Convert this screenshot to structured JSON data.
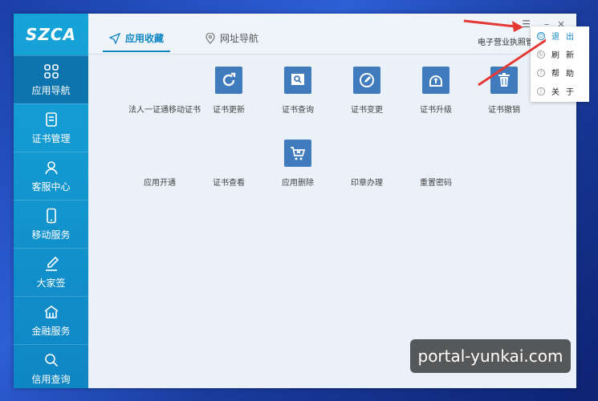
{
  "app": {
    "logo_text": "SZCA"
  },
  "sidebar": {
    "items": [
      {
        "label": "应用导航",
        "icon": "apps-icon",
        "active": true
      },
      {
        "label": "证书管理",
        "icon": "document-icon"
      },
      {
        "label": "客服中心",
        "icon": "user-icon"
      },
      {
        "label": "移动服务",
        "icon": "phone-icon"
      },
      {
        "label": "大家签",
        "icon": "sign-icon"
      },
      {
        "label": "金融服务",
        "icon": "bank-icon"
      },
      {
        "label": "信用查询",
        "icon": "search-icon"
      }
    ]
  },
  "tabs": [
    {
      "label": "应用收藏",
      "icon": "send-icon",
      "active": true
    },
    {
      "label": "网址导航",
      "icon": "location-pin-icon"
    }
  ],
  "license_text": "电子营业执照管",
  "window_controls": {
    "menu": "☰",
    "minimize": "–",
    "close": "×"
  },
  "apps_row1": [
    {
      "label": "法人一证通移动证书",
      "icon": null
    },
    {
      "label": "证书更新",
      "icon": "refresh-icon"
    },
    {
      "label": "证书查询",
      "icon": "magnify-icon"
    },
    {
      "label": "证书变更",
      "icon": "edit-icon"
    },
    {
      "label": "证书升级",
      "icon": "upgrade-icon"
    },
    {
      "label": "证书撤销",
      "icon": "trash-icon"
    }
  ],
  "apps_row2": [
    {
      "label": "应用开通",
      "icon": null
    },
    {
      "label": "证书查看",
      "icon": null
    },
    {
      "label": "应用删除",
      "icon": "cart-delete-icon"
    },
    {
      "label": "印章办理",
      "icon": null
    },
    {
      "label": "重置密码",
      "icon": null
    }
  ],
  "dropdown": {
    "items": [
      {
        "label": "退出",
        "icon": "power-icon",
        "highlight": true
      },
      {
        "label": "刷新",
        "icon": "refresh-small-icon"
      },
      {
        "label": "帮助",
        "icon": "help-icon"
      },
      {
        "label": "关于",
        "icon": "info-icon"
      }
    ]
  },
  "watermark": "portal-yunkai.com",
  "colors": {
    "sidebar": "#16a4d8",
    "accent": "#0f86c4",
    "icon_bg": "#3f7bbd",
    "arrow": "#e53935"
  }
}
